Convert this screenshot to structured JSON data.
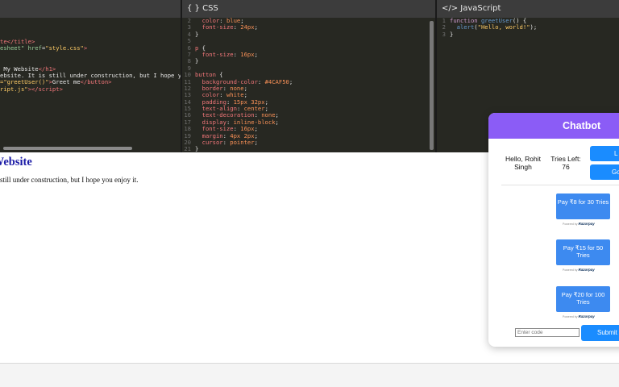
{
  "html_pane": {
    "lines": [
      {
        "html": "<span class=\"c-tag\">te</span><span class=\"c-tag\">&lt;/title&gt;</span>"
      },
      {
        "html": "<span class=\"c-attr\">esheet\"</span> <span class=\"c-attr\">href</span>=<span class=\"c-str\">\"style.css\"</span><span class=\"c-tag\">&gt;</span>"
      },
      {
        "html": ""
      },
      {
        "html": ""
      },
      {
        "html": " My Website<span class=\"c-tag\">&lt;/h1&gt;</span>"
      },
      {
        "html": "ebsite. It is still under construction, but I hope y"
      },
      {
        "html": "<span class=\"c-str\">=\"greetUser()\"</span><span class=\"c-tag\">&gt;</span>Greet me<span class=\"c-tag\">&lt;/button&gt;</span>"
      },
      {
        "html": "<span class=\"c-str\">ript.js\"</span><span class=\"c-tag\">&gt;&lt;/script&gt;</span>"
      }
    ]
  },
  "css_pane": {
    "header": "{ } CSS",
    "lines": [
      {
        "n": "2",
        "html": "  <span class=\"c-prop\">color</span>: <span class=\"c-val\">blue</span>;"
      },
      {
        "n": "3",
        "html": "  <span class=\"c-prop\">font-size</span>: <span class=\"c-val\">24px</span>;"
      },
      {
        "n": "4",
        "html": "}"
      },
      {
        "n": "5",
        "html": ""
      },
      {
        "n": "6",
        "html": "<span class=\"c-prop\">p</span> {"
      },
      {
        "n": "7",
        "html": "  <span class=\"c-prop\">font-size</span>: <span class=\"c-val\">16px</span>;"
      },
      {
        "n": "8",
        "html": "}"
      },
      {
        "n": "9",
        "html": ""
      },
      {
        "n": "10",
        "html": "<span class=\"c-prop\">button</span> {"
      },
      {
        "n": "11",
        "html": "  <span class=\"c-prop\">background-color</span>: <span class=\"c-val\">#4CAF50</span>;"
      },
      {
        "n": "12",
        "html": "  <span class=\"c-prop\">border</span>: <span class=\"c-val\">none</span>;"
      },
      {
        "n": "13",
        "html": "  <span class=\"c-prop\">color</span>: <span class=\"c-val\">white</span>;"
      },
      {
        "n": "14",
        "html": "  <span class=\"c-prop\">padding</span>: <span class=\"c-val\">15px 32px</span>;"
      },
      {
        "n": "15",
        "html": "  <span class=\"c-prop\">text-align</span>: <span class=\"c-val\">center</span>;"
      },
      {
        "n": "16",
        "html": "  <span class=\"c-prop\">text-decoration</span>: <span class=\"c-val\">none</span>;"
      },
      {
        "n": "17",
        "html": "  <span class=\"c-prop\">display</span>: <span class=\"c-val\">inline-block</span>;"
      },
      {
        "n": "18",
        "html": "  <span class=\"c-prop\">font-size</span>: <span class=\"c-val\">16px</span>;"
      },
      {
        "n": "19",
        "html": "  <span class=\"c-prop\">margin</span>: <span class=\"c-val\">4px 2px</span>;"
      },
      {
        "n": "20",
        "html": "  <span class=\"c-prop\">cursor</span>: <span class=\"c-val\">pointer</span>;"
      },
      {
        "n": "21",
        "html": "}"
      }
    ]
  },
  "js_pane": {
    "header": "</> JavaScript",
    "lines": [
      {
        "n": "1",
        "html": "<span class=\"c-kw\">function</span> <span class=\"c-fn\">greetUser</span>() {"
      },
      {
        "n": "2",
        "html": "  <span class=\"c-fn\">alert</span>(<span class=\"c-str\">\"Hello, world!\"</span>);"
      },
      {
        "n": "3",
        "html": "}"
      }
    ]
  },
  "output": {
    "title": "y Website",
    "text": "still under construction, but I hope you enjoy it."
  },
  "chatbot": {
    "title": "Chatbot",
    "greeting": "Hello, Rohit Singh",
    "tries_label": "Tries Left: 76",
    "login_label": "L",
    "google_label": "Go",
    "plans": [
      {
        "label": "Pay ₹8 for 30 Tries"
      },
      {
        "label": "Pay ₹15 for 50 Tries"
      },
      {
        "label": "Pay ₹20 for 100 Tries"
      }
    ],
    "powered_prefix": "Powered by",
    "powered_brand": "Razorpay",
    "code_placeholder": "Enter code",
    "submit_label": "Submit t"
  },
  "colors": {
    "chat_header": "#8b5cf6",
    "button_blue": "#1a8cff",
    "pay_blue": "#3d8af0",
    "editor_bg": "#272822"
  }
}
